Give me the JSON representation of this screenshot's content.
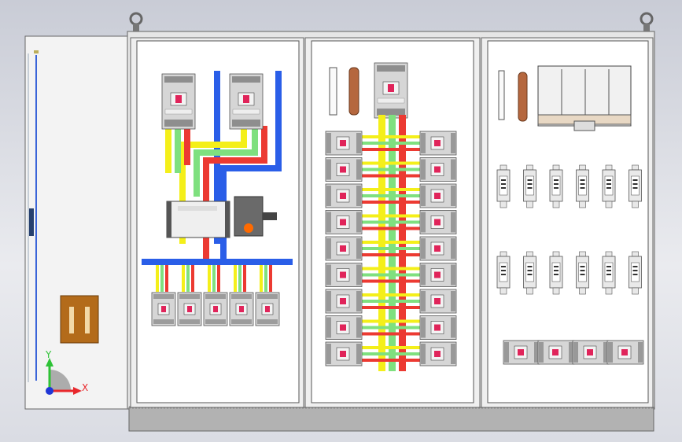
{
  "viewport": {
    "background_top": "#c9ccd6",
    "background_bottom": "#e2e3e8"
  },
  "triad": {
    "x_label": "X",
    "y_label": "Y",
    "x_color": "#e8282c",
    "y_color": "#2ec236",
    "z_color": "#1f36d6"
  },
  "colors": {
    "phase_yellow": "#f4ef1a",
    "phase_green": "#7fe07f",
    "phase_red": "#ec3a32",
    "neutral_blue": "#2a5ee8",
    "breaker_body": "#d9d9d9",
    "breaker_handle": "#e0245a",
    "cabinet_panel": "#ffffff",
    "cabinet_frame": "#9a9a9a",
    "door": "#f2f2f2",
    "plinth": "#b3b3b3",
    "terminal_copper": "#b5673e",
    "handle_brown": "#a8651d"
  },
  "scene": {
    "sections": [
      "door",
      "incomer-section",
      "distribution-section",
      "fuse-section"
    ],
    "incomer_breaker_count": 2,
    "outgoing_breaker_count": 5,
    "distribution_rows": 9,
    "fuse_rows": 2,
    "fuses_per_row": 6,
    "small_breaker_count": 4
  }
}
